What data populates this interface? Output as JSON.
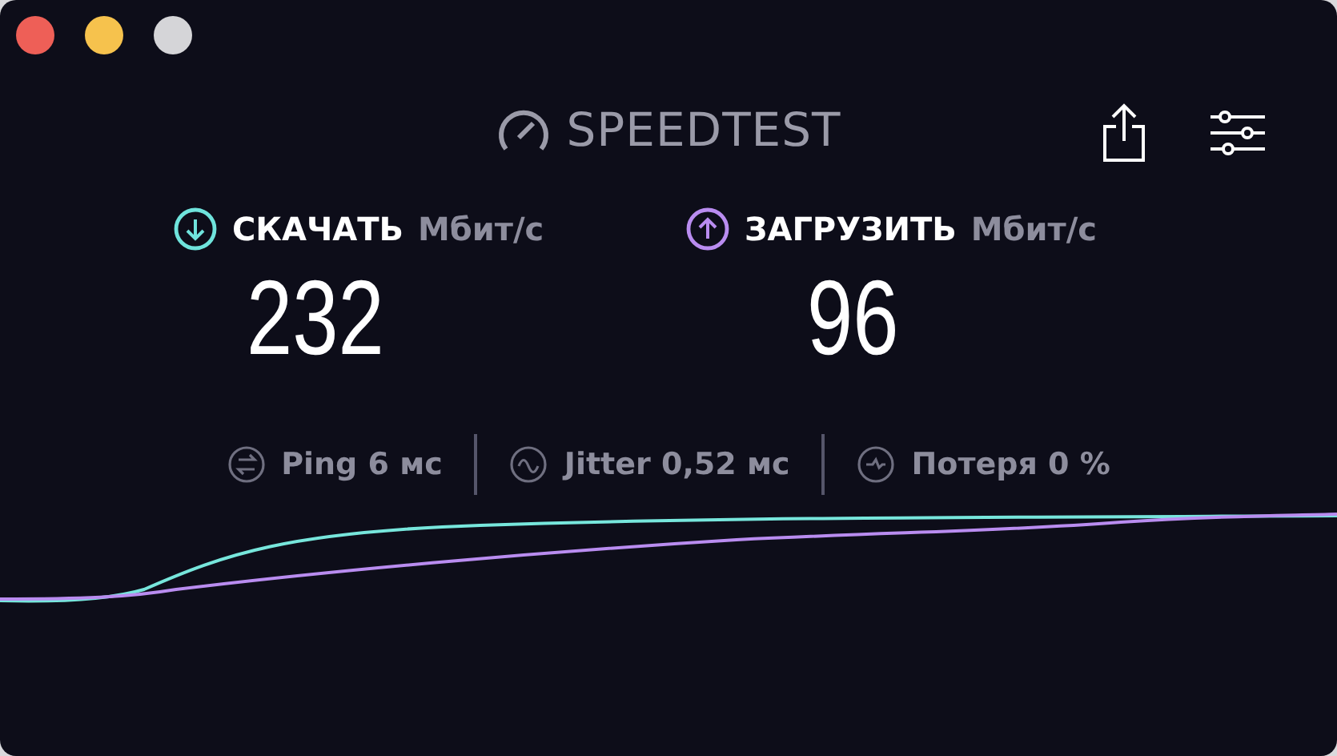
{
  "logo": {
    "text": "SPEEDTEST"
  },
  "metrics": [
    {
      "kind": "download",
      "label": "СКАЧАТЬ",
      "unit": "Мбит/с",
      "value": "232"
    },
    {
      "kind": "upload",
      "label": "ЗАГРУЗИТЬ",
      "unit": "Мбит/с",
      "value": "96"
    }
  ],
  "stats": [
    {
      "kind": "ping",
      "text": "Ping 6 мс"
    },
    {
      "kind": "jitter",
      "text": "Jitter 0,52 мс"
    },
    {
      "kind": "loss",
      "text": "Потеря 0 %"
    }
  ]
}
